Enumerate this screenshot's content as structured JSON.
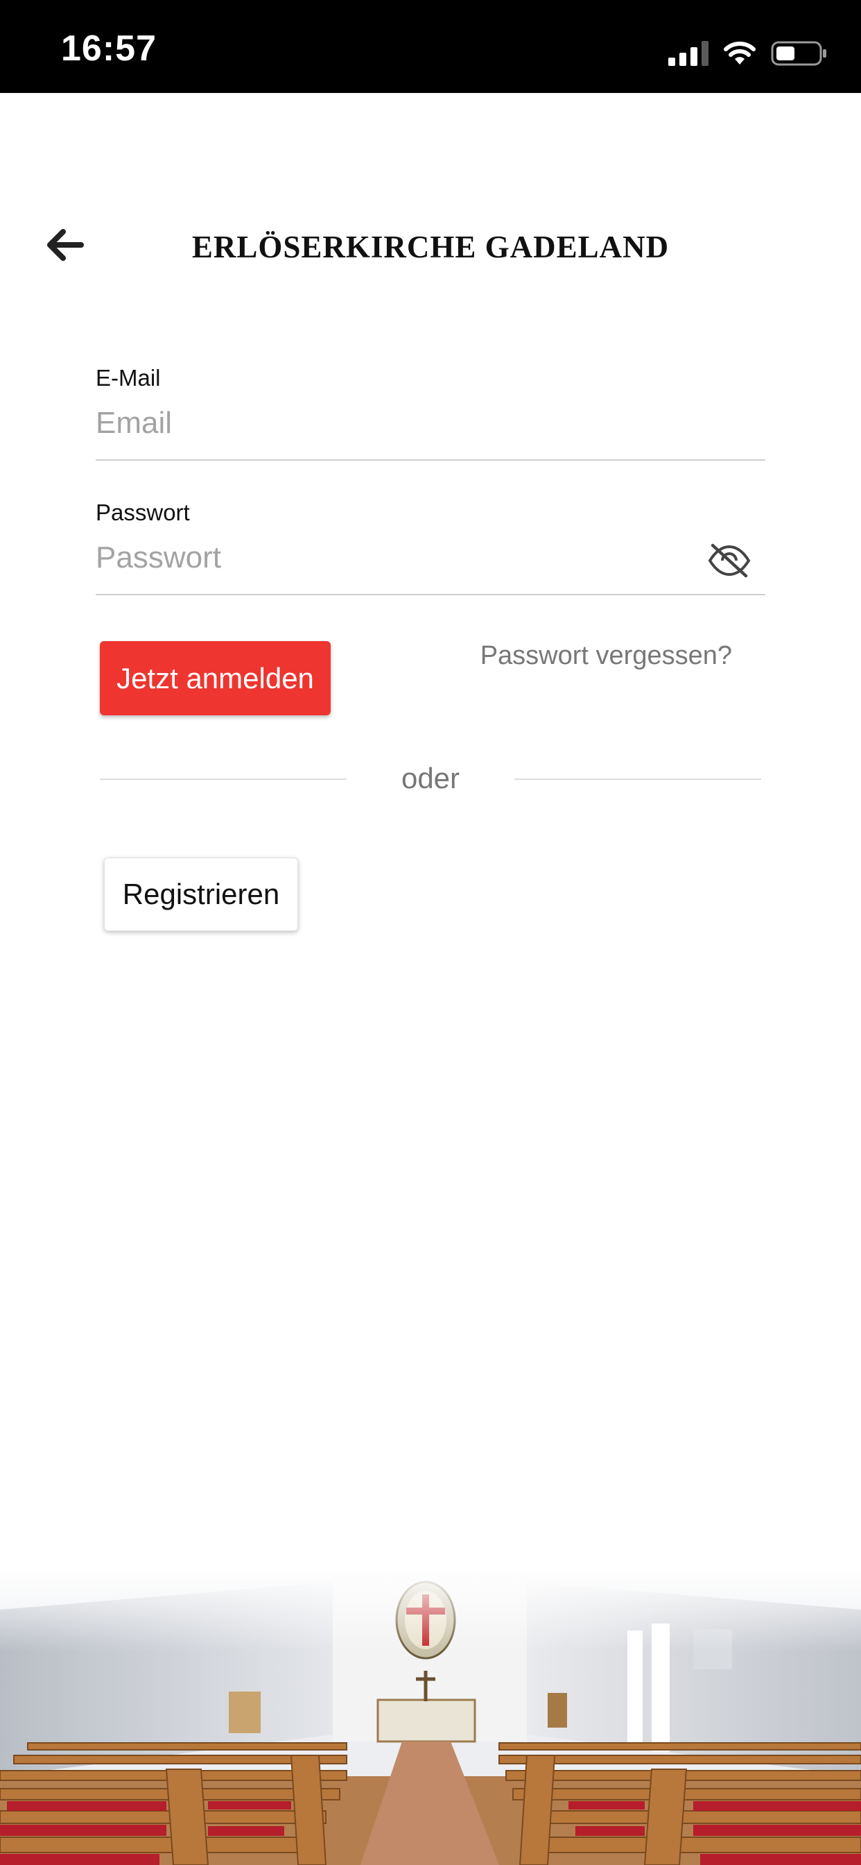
{
  "status_bar": {
    "time": "16:57",
    "icons": [
      "signal-icon",
      "wifi-icon",
      "battery-icon"
    ]
  },
  "header": {
    "back_icon": "arrow-left-icon",
    "title": "ERLÖSERKIRCHE GADELAND"
  },
  "form": {
    "email": {
      "label": "E-Mail",
      "placeholder": "Email",
      "value": ""
    },
    "password": {
      "label": "Passwort",
      "placeholder": "Passwort",
      "value": "",
      "toggle_icon": "eye-off-icon"
    },
    "login_label": "Jetzt anmelden",
    "forgot_label": "Passwort vergessen?",
    "divider_label": "oder",
    "register_label": "Registrieren"
  },
  "colors": {
    "primary": "#ee3530",
    "status_bar": "#000000",
    "muted_text": "#777777"
  },
  "footer_image": "church-interior-image"
}
